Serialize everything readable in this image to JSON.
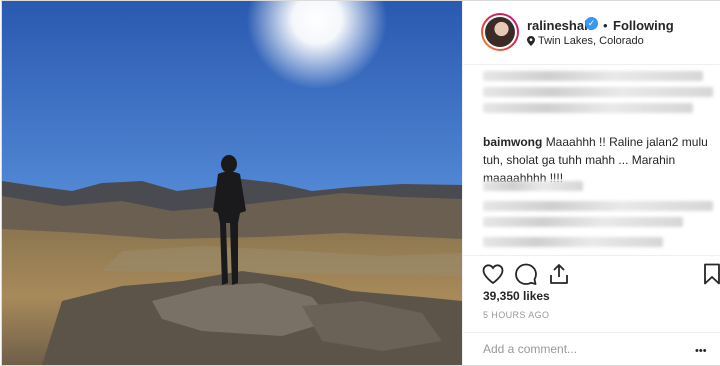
{
  "post": {
    "username": "ralineshah",
    "follow_separator": "•",
    "follow_status": "Following",
    "location": "Twin Lakes, Colorado",
    "likes": "39,350 likes",
    "timestamp": "5 HOURS AGO",
    "comment_placeholder": "Add a comment...",
    "more_label": "•••"
  },
  "comment": {
    "user": "baimwong",
    "text": "Maaahhh !! Raline jalan2 mulu tuh, sholat ga tuhh mahh ... Marahin maaaahhhh !!!!"
  },
  "icons": {
    "verified": "verified-badge-icon",
    "location": "location-pin-icon",
    "like": "heart-icon",
    "comment": "comment-bubble-icon",
    "share": "share-icon",
    "save": "bookmark-icon"
  },
  "colors": {
    "verified": "#3897f0",
    "text": "#262626",
    "muted": "#999999",
    "sky_top": "#2f5fb8",
    "sky_bottom": "#8fb3e0"
  }
}
